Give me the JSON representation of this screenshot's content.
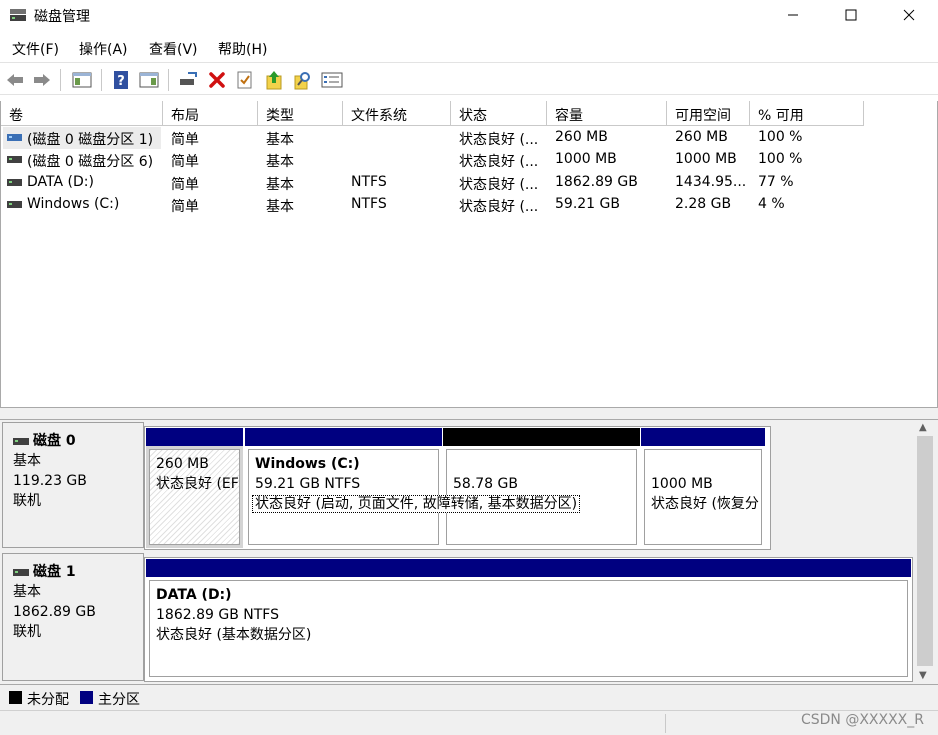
{
  "window": {
    "title": "磁盘管理",
    "controls": {
      "minimize": "minimize-icon",
      "maximize": "maximize-icon",
      "close": "close-icon"
    }
  },
  "menu": [
    {
      "label": "文件(F)"
    },
    {
      "label": "操作(A)"
    },
    {
      "label": "查看(V)"
    },
    {
      "label": "帮助(H)"
    }
  ],
  "toolbar": {
    "icons": [
      "back-arrow-icon",
      "forward-arrow-icon",
      "show-hide-pane-icon",
      "help-icon",
      "properties-pane-icon",
      "connect-disk-icon",
      "delete-icon",
      "checklist-icon",
      "up-arrow-icon",
      "search-icon",
      "properties-list-icon"
    ]
  },
  "columns": [
    "卷",
    "布局",
    "类型",
    "文件系统",
    "状态",
    "容量",
    "可用空间",
    "% 可用"
  ],
  "volumes": [
    {
      "name": "(磁盘 0 磁盘分区 1)",
      "layout": "简单",
      "type": "基本",
      "fs": "",
      "status": "状态良好 (...",
      "capacity": "260 MB",
      "free": "260 MB",
      "pct": "100 %",
      "icon_color": "#3a6fb5"
    },
    {
      "name": "(磁盘 0 磁盘分区 6)",
      "layout": "简单",
      "type": "基本",
      "fs": "",
      "status": "状态良好 (...",
      "capacity": "1000 MB",
      "free": "1000 MB",
      "pct": "100 %",
      "icon_color": "#404040"
    },
    {
      "name": "DATA (D:)",
      "layout": "简单",
      "type": "基本",
      "fs": "NTFS",
      "status": "状态良好 (...",
      "capacity": "1862.89 GB",
      "free": "1434.95...",
      "pct": "77 %",
      "icon_color": "#404040"
    },
    {
      "name": "Windows (C:)",
      "layout": "简单",
      "type": "基本",
      "fs": "NTFS",
      "status": "状态良好 (...",
      "capacity": "59.21 GB",
      "free": "2.28 GB",
      "pct": "4 %",
      "icon_color": "#404040"
    }
  ],
  "disks": [
    {
      "name": "磁盘 0",
      "kind": "基本",
      "size": "119.23 GB",
      "state": "联机",
      "partitions": [
        {
          "title": "",
          "size": "260 MB",
          "status": "状态良好 (EF",
          "bar_color": "#000080",
          "hatched": true
        },
        {
          "title": "Windows  (C:)",
          "size": "59.21 GB NTFS",
          "status": "状态良好 (启动, 页面文件, 故障转储, 基本数据分区)",
          "bar_color": "#000080",
          "hatched": false
        },
        {
          "title": "",
          "size": "58.78 GB",
          "status": "",
          "bar_color": "#000000",
          "hatched": false
        },
        {
          "title": "",
          "size": "1000 MB",
          "status": "状态良好 (恢复分",
          "bar_color": "#000080",
          "hatched": false
        }
      ]
    },
    {
      "name": "磁盘 1",
      "kind": "基本",
      "size": "1862.89 GB",
      "state": "联机",
      "partitions": [
        {
          "title": "DATA  (D:)",
          "size": "1862.89 GB NTFS",
          "status": "状态良好 (基本数据分区)",
          "bar_color": "#000080",
          "hatched": false
        }
      ]
    }
  ],
  "legend": [
    {
      "label": "未分配",
      "color": "#000000"
    },
    {
      "label": "主分区",
      "color": "#000080"
    }
  ],
  "watermark": "CSDN @XXXXX_R"
}
